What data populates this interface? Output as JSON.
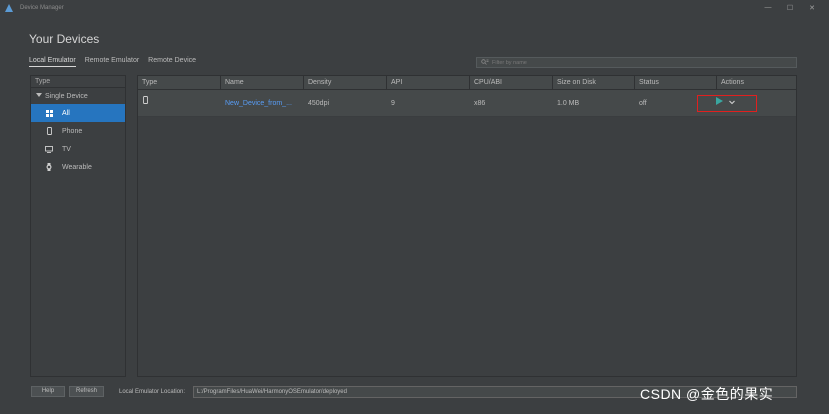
{
  "window": {
    "title": "Device Manager",
    "controls": [
      "—",
      "☐",
      "✕"
    ]
  },
  "page": {
    "title": "Your Devices"
  },
  "tabs": [
    "Local Emulator",
    "Remote Emulator",
    "Remote Device"
  ],
  "filter": {
    "placeholder": "Filter by name"
  },
  "sidebar": {
    "header": "Type",
    "group": "Single Device",
    "items": [
      {
        "label": "All",
        "icon": "grid-icon"
      },
      {
        "label": "Phone",
        "icon": "phone-icon"
      },
      {
        "label": "TV",
        "icon": "tv-icon"
      },
      {
        "label": "Wearable",
        "icon": "watch-icon"
      }
    ]
  },
  "table": {
    "columns": [
      "Type",
      "Name",
      "Density",
      "API",
      "CPU/ABI",
      "Size on Disk",
      "Status",
      "Actions"
    ],
    "rows": [
      {
        "type_icon": "phone-icon",
        "name": "New_Device_from_...",
        "density": "450dpi",
        "api": "9",
        "cpu": "x86",
        "size": "1.0 MB",
        "status": "off"
      }
    ]
  },
  "footer": {
    "help_label": "Help",
    "refresh_label": "Refresh",
    "location_label": "Local Emulator Location:",
    "location_value": "L:/ProgramFiles/HuaWei/HarmonyOSEmulator/deployed"
  },
  "watermark": "CSDN @金色的果实",
  "colors": {
    "accent": "#2675bf",
    "link": "#589df6",
    "play": "#3aa6a0",
    "highlight_box": "#e0201f"
  }
}
